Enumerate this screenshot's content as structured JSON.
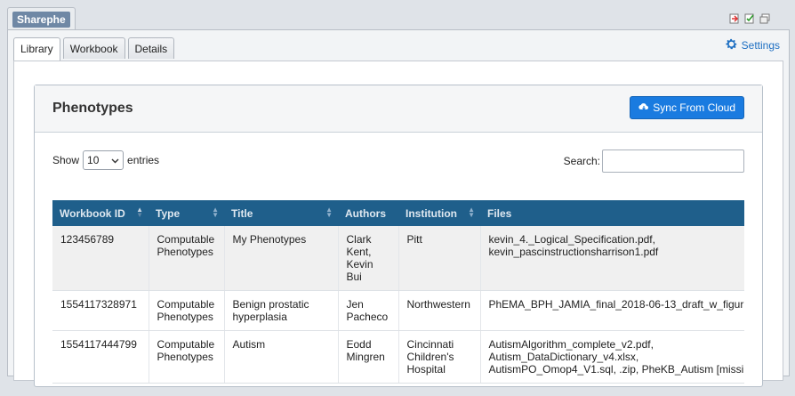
{
  "window": {
    "title": "Sharephe",
    "icons": [
      "export-icon",
      "check-icon",
      "restore-icon"
    ]
  },
  "tabs": [
    {
      "label": "Library",
      "active": true
    },
    {
      "label": "Workbook",
      "active": false
    },
    {
      "label": "Details",
      "active": false
    }
  ],
  "settings": {
    "label": "Settings",
    "icon": "gear-icon"
  },
  "card": {
    "title": "Phenotypes",
    "sync_button": {
      "label": "Sync From Cloud",
      "icon": "cloud-icon"
    }
  },
  "controls": {
    "show_label": "Show",
    "page_size": "10",
    "entries_label": "entries",
    "search_label": "Search:",
    "search_value": ""
  },
  "table": {
    "columns": [
      "Workbook ID",
      "Type",
      "Title",
      "Authors",
      "Institution",
      "Files"
    ],
    "rows": [
      {
        "id": "123456789",
        "type": "Computable Phenotypes",
        "title": "My Phenotypes",
        "authors": "Clark Kent, Kevin Bui",
        "institution": "Pitt",
        "files": "kevin_4._Logical_Specification.pdf, kevin_pascinstructionsharrison1.pdf"
      },
      {
        "id": "1554117328971",
        "type": "Computable Phenotypes",
        "title": "Benign prostatic hyperplasia",
        "authors": "Jen Pacheco",
        "institution": "Northwestern",
        "files": "PhEMA_BPH_JAMIA_final_2018-06-13_draft_w_figur"
      },
      {
        "id": "1554117444799",
        "type": "Computable Phenotypes",
        "title": "Autism",
        "authors": "Eodd Mingren",
        "institution": "Cincinnati Children's Hospital",
        "files": "AutismAlgorithm_complete_v2.pdf, Autism_DataDictionary_v4.xlsx, AutismPO_Omop4_V1.sql, .zip, PheKB_Autism [missi"
      }
    ]
  },
  "colors": {
    "header_bg": "#1f5f8b",
    "accent": "#1a7be0",
    "link": "#1e6fc2"
  }
}
